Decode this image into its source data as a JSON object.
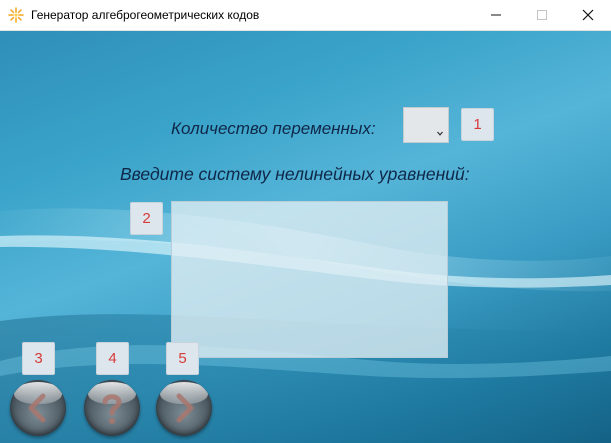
{
  "window": {
    "title": "Генератор алгеброгеометрических кодов",
    "app_icon": "sparkle-icon",
    "controls": [
      "minimize-icon",
      "maximize-icon",
      "close-icon"
    ]
  },
  "form": {
    "variables_label": "Количество переменных:",
    "variables_value": "",
    "system_label": "Введите систему нелинейных уравнений:",
    "equations_text": ""
  },
  "markers": [
    "1",
    "2",
    "3",
    "4",
    "5"
  ],
  "buttons": {
    "back": "arrow-left-icon",
    "help": "question-icon",
    "next": "arrow-right-icon"
  },
  "colors": {
    "label_text": "#0f2748",
    "marker_text": "#d83b3b",
    "background_mid": "#3aa3c9"
  }
}
